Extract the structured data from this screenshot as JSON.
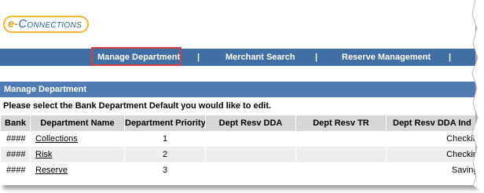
{
  "logo": {
    "e": "e-",
    "text": "Connections"
  },
  "nav": {
    "items": [
      {
        "label": "Manage Department"
      },
      {
        "label": "Merchant Search"
      },
      {
        "label": "Reserve Management"
      }
    ],
    "separator": "|"
  },
  "section": {
    "title": "Manage Department"
  },
  "instructions": "Please select the Bank Department Default you would like to edit.",
  "table": {
    "headers": [
      "Bank",
      "Department Name",
      "Department Priority",
      "Dept Resv DDA",
      "Dept Resv TR",
      "Dept Resv DDA Ind"
    ],
    "rows": [
      {
        "bank": "####",
        "dept": "Collections",
        "priority": "1",
        "dda": "",
        "tr": "",
        "ddaind": "Checking"
      },
      {
        "bank": "####",
        "dept": "Risk",
        "priority": "2",
        "dda": "",
        "tr": "",
        "ddaind": "Checking"
      },
      {
        "bank": "####",
        "dept": "Reserve",
        "priority": "3",
        "dda": "",
        "tr": "",
        "ddaind": "Savings"
      }
    ]
  },
  "colors": {
    "nav_bg": "#3f6fa3",
    "section_bg": "#4f7db3",
    "header_bg": "#d6d6d6",
    "alt_row": "#eeeeee",
    "highlight": "#d83c3c",
    "logo_blue": "#2a62a8",
    "logo_gold": "#f0b733"
  }
}
